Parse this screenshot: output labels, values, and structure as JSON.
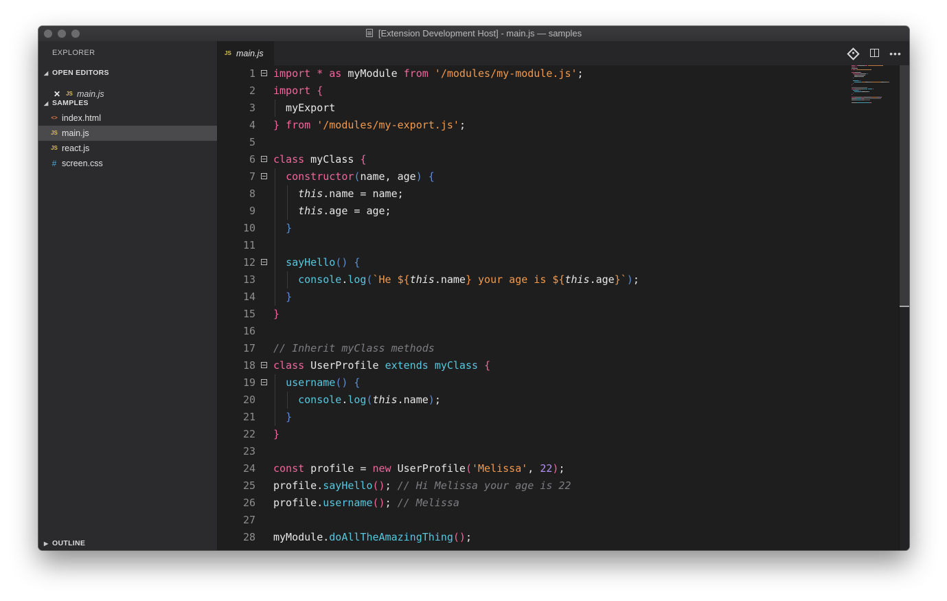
{
  "window": {
    "title": "[Extension Development Host] - main.js — samples",
    "title_icon": "document-icon"
  },
  "sidebar": {
    "title": "EXPLORER",
    "open_editors": {
      "label": "OPEN EDITORS",
      "items": [
        {
          "label": "main.js",
          "icon": "JS"
        }
      ]
    },
    "samples": {
      "label": "SAMPLES",
      "items": [
        {
          "label": "index.html",
          "icon": "<>",
          "icon_color": "#e0774a"
        },
        {
          "label": "main.js",
          "icon": "JS",
          "icon_color": "#d8c14b",
          "selected": true
        },
        {
          "label": "react.js",
          "icon": "JS",
          "icon_color": "#d8c14b"
        },
        {
          "label": "screen.css",
          "icon": "#",
          "icon_color": "#4fa6d6"
        }
      ]
    },
    "outline_label": "OUTLINE"
  },
  "editor": {
    "tab": {
      "label": "main.js",
      "icon": "JS"
    },
    "actions": [
      "open-changes-icon",
      "split-editor-icon",
      "more-actions-icon"
    ],
    "lines": [
      {
        "n": "1",
        "fold": true,
        "tokens": [
          [
            "k",
            "import"
          ],
          [
            "p",
            " "
          ],
          [
            "k",
            "*"
          ],
          [
            "p",
            " "
          ],
          [
            "k",
            "as"
          ],
          [
            "p",
            " myModule "
          ],
          [
            "k",
            "from"
          ],
          [
            "p",
            " "
          ],
          [
            "s",
            "'/modules/my-module.js'"
          ],
          [
            "p",
            ";"
          ]
        ]
      },
      {
        "n": "2",
        "tokens": [
          [
            "k",
            "import"
          ],
          [
            "p",
            " "
          ],
          [
            "b",
            "{"
          ]
        ]
      },
      {
        "n": "3",
        "tokens": [
          [
            "p",
            "  myExport"
          ]
        ]
      },
      {
        "n": "4",
        "tokens": [
          [
            "b",
            "}"
          ],
          [
            "p",
            " "
          ],
          [
            "k",
            "from"
          ],
          [
            "p",
            " "
          ],
          [
            "s",
            "'/modules/my-export.js'"
          ],
          [
            "p",
            ";"
          ]
        ]
      },
      {
        "n": "5",
        "tokens": []
      },
      {
        "n": "6",
        "fold": true,
        "tokens": [
          [
            "k",
            "class"
          ],
          [
            "p",
            " myClass "
          ],
          [
            "b",
            "{"
          ]
        ]
      },
      {
        "n": "7",
        "fold": true,
        "tokens": [
          [
            "p",
            "  "
          ],
          [
            "k",
            "constructor"
          ],
          [
            "bb",
            "("
          ],
          [
            "p",
            "name, age"
          ],
          [
            "bb",
            ")"
          ],
          [
            "p",
            " "
          ],
          [
            "bb",
            "{"
          ]
        ]
      },
      {
        "n": "8",
        "tokens": [
          [
            "p",
            "    "
          ],
          [
            "i",
            "this"
          ],
          [
            "p",
            ".name = name;"
          ]
        ]
      },
      {
        "n": "9",
        "tokens": [
          [
            "p",
            "    "
          ],
          [
            "i",
            "this"
          ],
          [
            "p",
            ".age = age;"
          ]
        ]
      },
      {
        "n": "10",
        "tokens": [
          [
            "p",
            "  "
          ],
          [
            "bb",
            "}"
          ]
        ]
      },
      {
        "n": "11",
        "tokens": []
      },
      {
        "n": "12",
        "fold": true,
        "tokens": [
          [
            "p",
            "  "
          ],
          [
            "f",
            "sayHello"
          ],
          [
            "bb",
            "()"
          ],
          [
            "p",
            " "
          ],
          [
            "bb",
            "{"
          ]
        ]
      },
      {
        "n": "13",
        "tokens": [
          [
            "p",
            "    "
          ],
          [
            "f",
            "console"
          ],
          [
            "p",
            "."
          ],
          [
            "f",
            "log"
          ],
          [
            "bb",
            "("
          ],
          [
            "s",
            "`He ${"
          ],
          [
            "i",
            "this"
          ],
          [
            "p",
            ".name"
          ],
          [
            "s",
            "} your age is ${"
          ],
          [
            "i",
            "this"
          ],
          [
            "p",
            ".age"
          ],
          [
            "s",
            "}`"
          ],
          [
            "bb",
            ")"
          ],
          [
            "p",
            ";"
          ]
        ]
      },
      {
        "n": "14",
        "tokens": [
          [
            "p",
            "  "
          ],
          [
            "bb",
            "}"
          ]
        ]
      },
      {
        "n": "15",
        "tokens": [
          [
            "b",
            "}"
          ]
        ]
      },
      {
        "n": "16",
        "tokens": []
      },
      {
        "n": "17",
        "tokens": [
          [
            "c",
            "// Inherit myClass methods"
          ]
        ]
      },
      {
        "n": "18",
        "fold": true,
        "tokens": [
          [
            "k",
            "class"
          ],
          [
            "p",
            " UserProfile "
          ],
          [
            "f",
            "extends"
          ],
          [
            "p",
            " "
          ],
          [
            "f",
            "myClass"
          ],
          [
            "p",
            " "
          ],
          [
            "b",
            "{"
          ]
        ]
      },
      {
        "n": "19",
        "fold": true,
        "tokens": [
          [
            "p",
            "  "
          ],
          [
            "f",
            "username"
          ],
          [
            "bb",
            "()"
          ],
          [
            "p",
            " "
          ],
          [
            "bb",
            "{"
          ]
        ]
      },
      {
        "n": "20",
        "tokens": [
          [
            "p",
            "    "
          ],
          [
            "f",
            "console"
          ],
          [
            "p",
            "."
          ],
          [
            "f",
            "log"
          ],
          [
            "bb",
            "("
          ],
          [
            "i",
            "this"
          ],
          [
            "p",
            ".name"
          ],
          [
            "bb",
            ")"
          ],
          [
            "p",
            ";"
          ]
        ]
      },
      {
        "n": "21",
        "tokens": [
          [
            "p",
            "  "
          ],
          [
            "bb",
            "}"
          ]
        ]
      },
      {
        "n": "22",
        "tokens": [
          [
            "b",
            "}"
          ]
        ]
      },
      {
        "n": "23",
        "tokens": []
      },
      {
        "n": "24",
        "tokens": [
          [
            "k",
            "const"
          ],
          [
            "p",
            " profile = "
          ],
          [
            "k",
            "new"
          ],
          [
            "p",
            " UserProfile"
          ],
          [
            "b",
            "("
          ],
          [
            "s",
            "'Melissa'"
          ],
          [
            "p",
            ", "
          ],
          [
            "n",
            "22"
          ],
          [
            "b",
            ")"
          ],
          [
            "p",
            ";"
          ]
        ]
      },
      {
        "n": "25",
        "tokens": [
          [
            "p",
            "profile."
          ],
          [
            "f",
            "sayHello"
          ],
          [
            "b",
            "()"
          ],
          [
            "p",
            "; "
          ],
          [
            "c",
            "// Hi Melissa your age is 22"
          ]
        ]
      },
      {
        "n": "26",
        "tokens": [
          [
            "p",
            "profile."
          ],
          [
            "f",
            "username"
          ],
          [
            "b",
            "()"
          ],
          [
            "p",
            "; "
          ],
          [
            "c",
            "// Melissa"
          ]
        ]
      },
      {
        "n": "27",
        "tokens": []
      },
      {
        "n": "28",
        "tokens": [
          [
            "p",
            "myModule."
          ],
          [
            "f",
            "doAllTheAmazingThing"
          ],
          [
            "b",
            "()"
          ],
          [
            "p",
            ";"
          ]
        ]
      }
    ]
  },
  "colors": {
    "keyword": "#f0679b",
    "string": "#f29a4c",
    "function": "#57c7e0",
    "comment": "#7d7d82",
    "number": "#b590f4",
    "bracket_inner": "#5b8fd0",
    "selection": "#4a4a4d"
  }
}
